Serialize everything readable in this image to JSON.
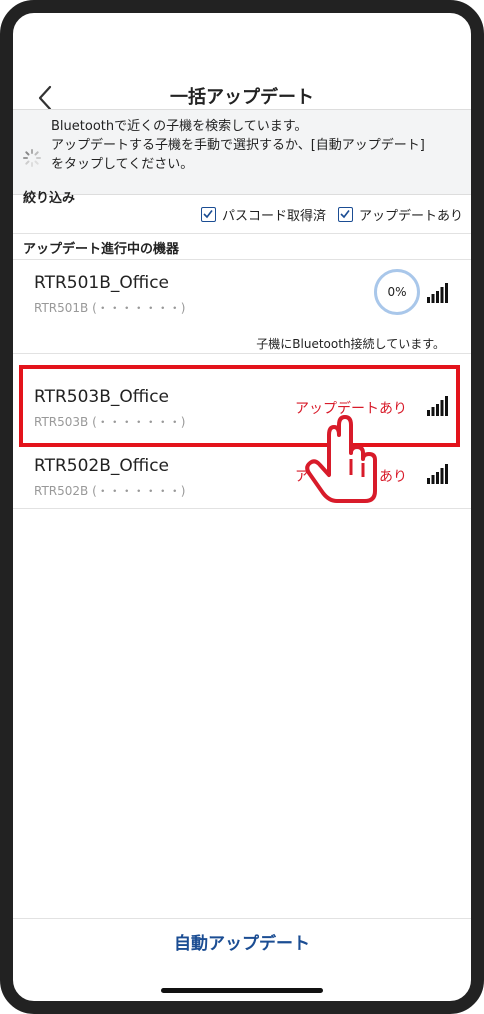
{
  "header": {
    "title": "一括アップデート"
  },
  "info": {
    "line1": "Bluetoothで近くの子機を検索しています。",
    "line2": "アップデートする子機を手動で選択するか、[自動アップデート]",
    "line3": "をタップしてください。"
  },
  "filter": {
    "label": "絞り込み",
    "option1": "パスコード取得済",
    "option2": "アップデートあり",
    "option1_checked": true,
    "option2_checked": true
  },
  "section_label": "アップデート進行中の機器",
  "devices": [
    {
      "name": "RTR501B_Office",
      "model": "RTR501B",
      "serial_masked": "(・・・・・・・)",
      "progress": "0%",
      "note": "子機にBluetooth接続しています。"
    },
    {
      "name": "RTR503B_Office",
      "model": "RTR503B",
      "serial_masked": "(・・・・・・・)",
      "status": "アップデートあり"
    },
    {
      "name": "RTR502B_Office",
      "model": "RTR502B",
      "serial_masked": "(・・・・・・・)",
      "status": "アップデートあり"
    }
  ],
  "footer": {
    "auto_update": "自動アップデート"
  },
  "colors": {
    "accent": "#1b4d93",
    "alert": "#d81b2a",
    "highlight": "#e3131b",
    "progress_ring": "#a9c7ea"
  },
  "icons": [
    "back-chevron-icon",
    "loading-spinner-icon",
    "checkbox-checked-icon",
    "signal-strength-icon",
    "pointing-hand-icon"
  ]
}
